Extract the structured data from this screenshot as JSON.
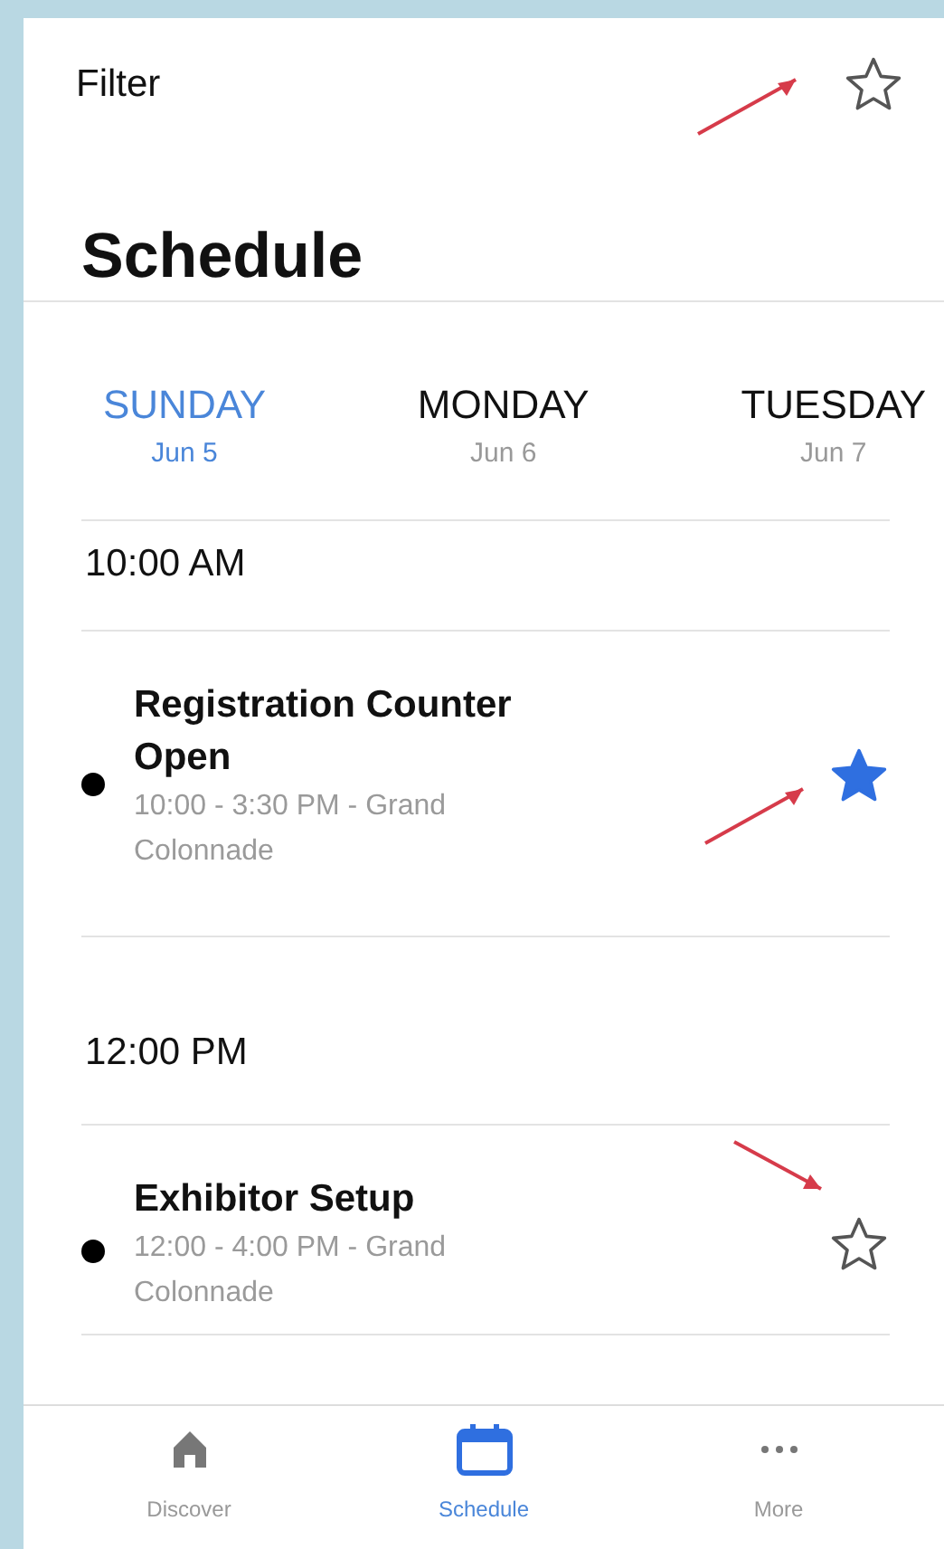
{
  "header": {
    "filter_label": "Filter",
    "favorites_only": false,
    "annotated": true
  },
  "title": "Schedule",
  "days": [
    {
      "name": "SUNDAY",
      "date": "Jun 5",
      "selected": true
    },
    {
      "name": "MONDAY",
      "date": "Jun 6",
      "selected": false
    },
    {
      "name": "TUESDAY",
      "date": "Jun 7",
      "selected": false
    }
  ],
  "time_groups": [
    {
      "time": "10:00 AM",
      "sessions": [
        {
          "title": "Registration Counter Open",
          "details": "10:00 - 3:30 PM - Grand Colonnade",
          "favorite": true,
          "annotated": true
        }
      ]
    },
    {
      "time": "12:00 PM",
      "sessions": [
        {
          "title": "Exhibitor Setup",
          "details": "12:00 - 4:00 PM - Grand Colonnade",
          "favorite": false,
          "annotated": true
        }
      ]
    }
  ],
  "tab_bar": [
    {
      "label": "Discover",
      "kind": "house",
      "selected": false
    },
    {
      "label": "Schedule",
      "kind": "calendar",
      "selected": true
    },
    {
      "label": "More",
      "kind": "dots",
      "selected": false
    }
  ]
}
